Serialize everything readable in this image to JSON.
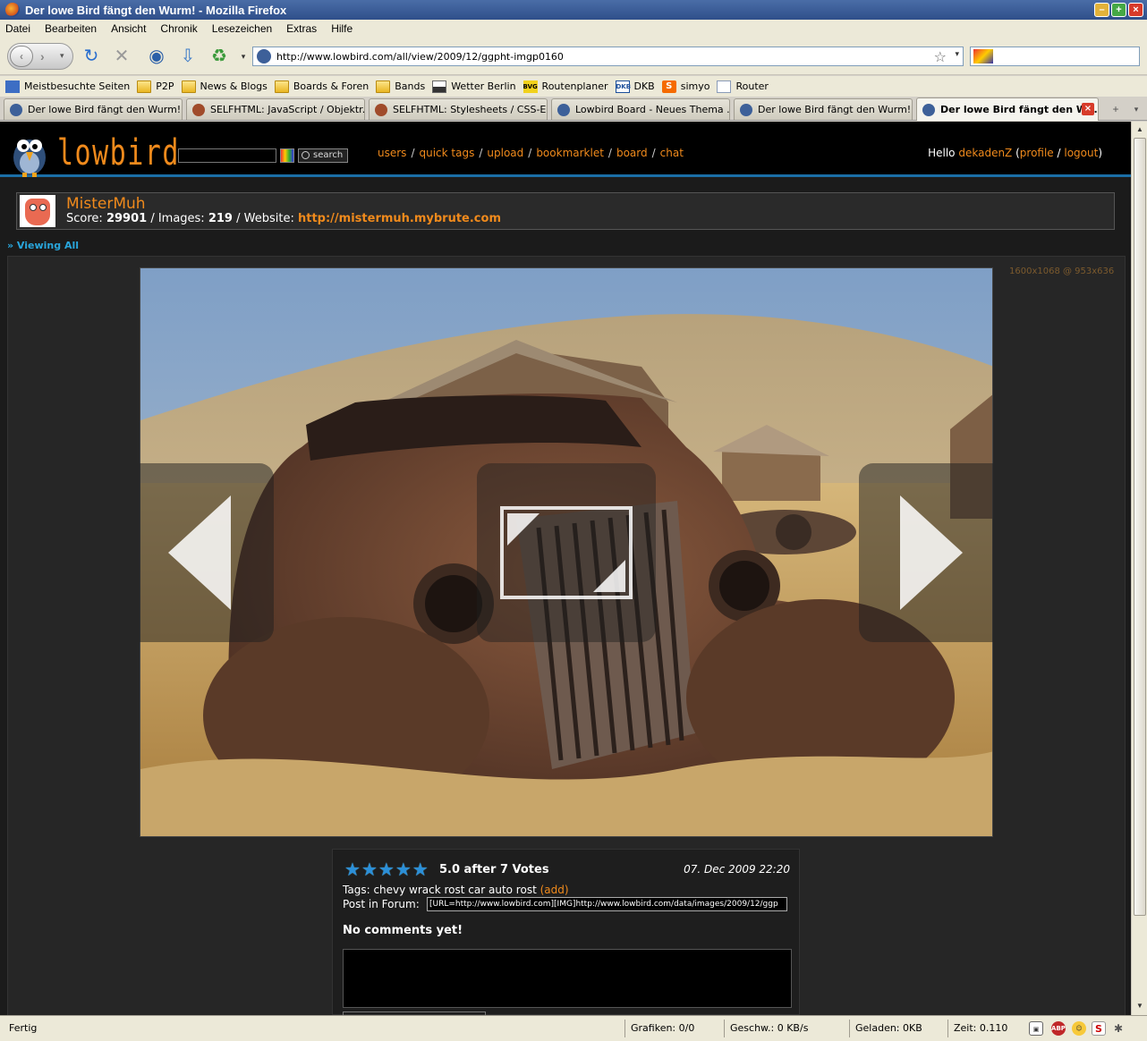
{
  "window": {
    "title": "Der lowe Bird fängt den Wurm! - Mozilla Firefox"
  },
  "menu": [
    "Datei",
    "Bearbeiten",
    "Ansicht",
    "Chronik",
    "Lesezeichen",
    "Extras",
    "Hilfe"
  ],
  "url": "http://www.lowbird.com/all/view/2009/12/ggpht-imgp0160",
  "bookmarks": [
    {
      "label": "Meistbesuchte Seiten",
      "icon": "blue"
    },
    {
      "label": "P2P",
      "icon": "folder"
    },
    {
      "label": "News & Blogs",
      "icon": "folder"
    },
    {
      "label": "Boards & Foren",
      "icon": "folder"
    },
    {
      "label": "Bands",
      "icon": "folder"
    },
    {
      "label": "Wetter Berlin",
      "icon": "weather"
    },
    {
      "label": "Routenplaner",
      "icon": "bvg"
    },
    {
      "label": "DKB",
      "icon": "dkb"
    },
    {
      "label": "simyo",
      "icon": "simyo"
    },
    {
      "label": "Router",
      "icon": "page"
    }
  ],
  "bookmark_icon_text": {
    "bvg": "BVG",
    "dkb": "DKB",
    "simyo": "S"
  },
  "tabs": [
    {
      "label": "Der lowe Bird fängt den Wurm!",
      "fav": "bird"
    },
    {
      "label": "SELFHTML: JavaScript / Objektr...",
      "fav": "self"
    },
    {
      "label": "SELFHTML: Stylesheets / CSS-Ei...",
      "fav": "self"
    },
    {
      "label": "Lowbird Board - Neues Thema ...",
      "fav": "bird"
    },
    {
      "label": "Der lowe Bird fängt den Wurm!",
      "fav": "bird"
    },
    {
      "label": "Der lowe Bird fängt den W...",
      "fav": "bird",
      "active": true
    }
  ],
  "site": {
    "logo": "lowbird",
    "search_button": "search",
    "nav": [
      "users",
      "quick tags",
      "upload",
      "bookmarklet",
      "board",
      "chat"
    ],
    "hello_prefix": "Hello",
    "user": "dekadenZ",
    "profile_link": "profile",
    "logout_link": "logout"
  },
  "profile": {
    "name": "MisterMuh",
    "score_label": "Score:",
    "score": "29901",
    "images_label": "/ Images:",
    "images": "219",
    "website_label": "/ Website:",
    "website": "http://mistermuh.mybrute.com"
  },
  "viewing": "» Viewing All",
  "resolution": "1600x1068 @ 953x636",
  "image": {
    "rating_stars": 5,
    "rating_text": "5.0 after 7 Votes",
    "date": "07. Dec 2009 22:20",
    "tags_label": "Tags:",
    "tags": "chevy wrack rost car auto rost",
    "tags_add": "(add)",
    "forum_label": "Post in Forum:",
    "forum_code": "[URL=http://www.lowbird.com][IMG]http://www.lowbird.com/data/images/2009/12/ggp",
    "no_comments": "No comments yet!"
  },
  "status": {
    "text": "Fertig",
    "graphics": "Grafiken: 0/0",
    "speed": "Geschw.: 0 KB/s",
    "loaded": "Geladen: 0KB",
    "time": "Zeit: 0.110"
  },
  "colors": {
    "accent_orange": "#f08a1c",
    "link_blue": "#29a6dc",
    "star_blue": "#2b8fd8",
    "header_line": "#1b6ea6"
  }
}
